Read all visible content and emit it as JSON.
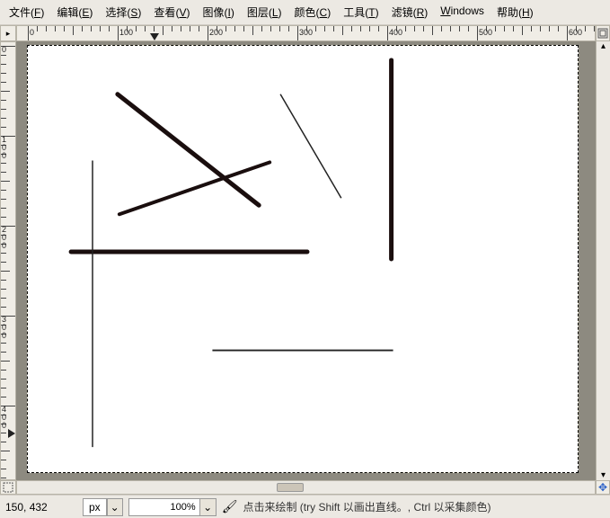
{
  "menu": {
    "file": {
      "label": "文件",
      "accel": "F"
    },
    "edit": {
      "label": "编辑",
      "accel": "E"
    },
    "select": {
      "label": "选择",
      "accel": "S"
    },
    "view": {
      "label": "查看",
      "accel": "V"
    },
    "image": {
      "label": "图像",
      "accel": "I"
    },
    "layer": {
      "label": "图层",
      "accel": "L"
    },
    "colors": {
      "label": "颜色",
      "accel": "C"
    },
    "tools": {
      "label": "工具",
      "accel": "T"
    },
    "filters": {
      "label": "滤镜",
      "accel": "R"
    },
    "windows": {
      "label": "Windows",
      "accel": "W"
    },
    "help": {
      "label": "帮助",
      "accel": "H"
    }
  },
  "ruler": {
    "h_labels": [
      "0",
      "100",
      "200",
      "300",
      "400",
      "500",
      "600"
    ],
    "v_labels": [
      "0",
      "100",
      "200",
      "300",
      "400"
    ]
  },
  "status": {
    "coords": "150, 432",
    "unit": "px",
    "zoom": "100%",
    "hint": "点击来绘制 (try Shift 以画出直线。, Ctrl 以采集颜色)"
  },
  "icons": {
    "origin": "▸",
    "eye": "◉",
    "dropdown": "⌄",
    "nav": "✥",
    "brush": "🖌"
  }
}
